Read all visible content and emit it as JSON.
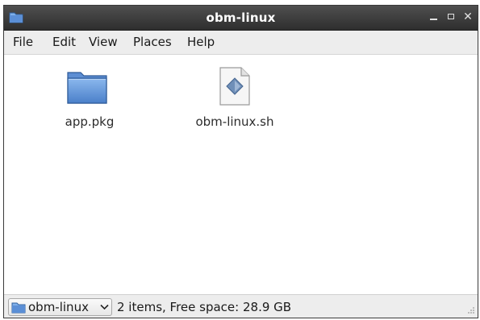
{
  "window": {
    "title": "obm-linux",
    "controls": [
      "minimize",
      "maximize",
      "close"
    ]
  },
  "menubar": {
    "items": [
      {
        "label": "File"
      },
      {
        "label": "Edit"
      },
      {
        "label": "View"
      },
      {
        "label": "Places"
      },
      {
        "label": "Help"
      }
    ]
  },
  "files": [
    {
      "name": "app.pkg",
      "icon": "folder-icon"
    },
    {
      "name": "obm-linux.sh",
      "icon": "shell-script-icon"
    }
  ],
  "statusbar": {
    "location": "obm-linux",
    "summary": "2 items, Free space: 28.9 GB"
  },
  "colors": {
    "titlebar": "#3a3a3a",
    "folder": "#5b8fd6",
    "menubar": "#ededed"
  }
}
